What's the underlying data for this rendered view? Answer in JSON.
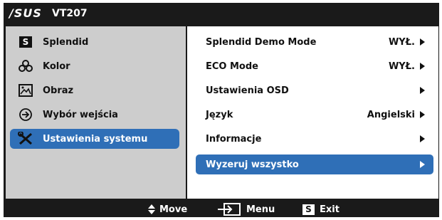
{
  "header": {
    "brand": "/SUS",
    "model": "VT207"
  },
  "sidebar": {
    "items": [
      {
        "label": "Splendid",
        "icon": "splendid-s-icon"
      },
      {
        "label": "Kolor",
        "icon": "color-icon"
      },
      {
        "label": "Obraz",
        "icon": "image-icon"
      },
      {
        "label": "Wybór wejścia",
        "icon": "input-select-icon"
      },
      {
        "label": "Ustawienia systemu",
        "icon": "tools-icon",
        "selected": true
      }
    ]
  },
  "main": {
    "items": [
      {
        "label": "Splendid Demo Mode",
        "value": "WYŁ."
      },
      {
        "label": "ECO Mode",
        "value": "WYŁ."
      },
      {
        "label": "Ustawienia OSD",
        "value": ""
      },
      {
        "label": "Język",
        "value": "Angielski"
      },
      {
        "label": "Informacje",
        "value": ""
      },
      {
        "label": "Wyzeruj wszystko",
        "value": "",
        "selected": true
      }
    ]
  },
  "footer": {
    "move_label": "Move",
    "menu_label": "Menu",
    "exit_label": "Exit",
    "exit_key": "S"
  },
  "colors": {
    "accent": "#2f6fb7",
    "frame": "#1a1a1a",
    "sidebar_bg": "#cdcdcd"
  }
}
